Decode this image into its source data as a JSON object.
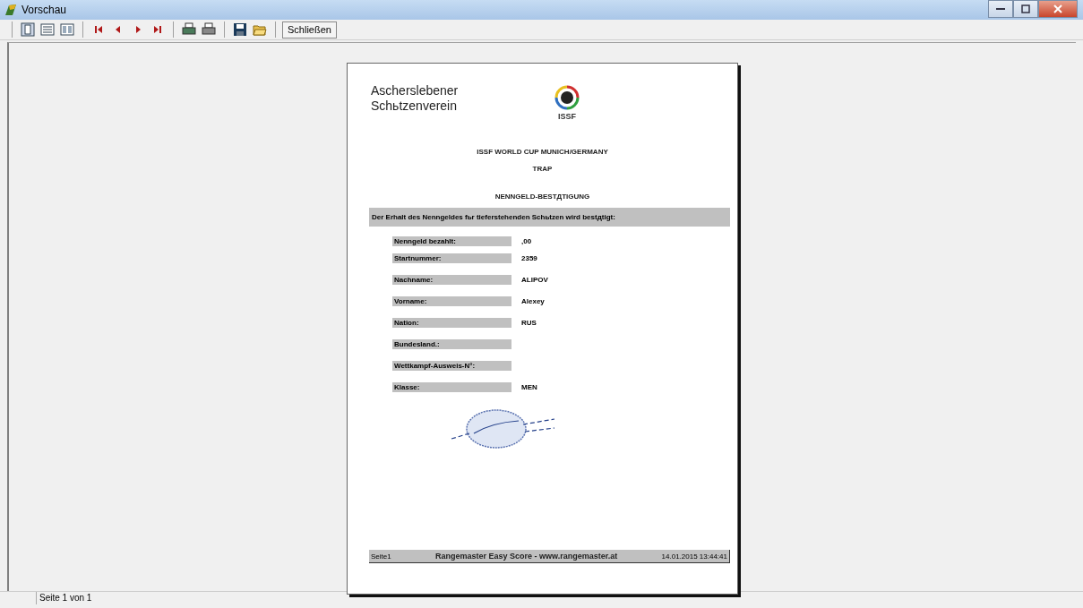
{
  "window": {
    "title": "Vorschau"
  },
  "toolbar": {
    "close_button": "Schließen"
  },
  "document": {
    "club": [
      "Ascherslebener",
      "Schьtzenverein"
    ],
    "logo_text": "ISSF",
    "event": "ISSF WORLD CUP MUNICH/GERMANY",
    "discipline": "TRAP",
    "heading": "NENNGELD-BESTДTIGUNG",
    "banner": "Der Erhalt des Nenngeldes fьr tieferstehenden Schьtzen wird bestдtigt:",
    "fields": [
      {
        "label": "Nenngeld bezahlt:",
        "value": ",00"
      },
      {
        "label": "Startnummer:",
        "value": "2359"
      },
      {
        "label": "Nachname:",
        "value": "ALIPOV"
      },
      {
        "label": "Vorname:",
        "value": "Alexey"
      },
      {
        "label": "Nation:",
        "value": "RUS"
      },
      {
        "label": "Bundesland.:"
      },
      {
        "label": "Wettkampf-Ausweis-N°:"
      },
      {
        "label": "Klasse:",
        "value": "MEN"
      }
    ],
    "footer": {
      "page": "Seite1",
      "center": "Rangemaster Easy Score - www.rangemaster.at",
      "timestamp": "14.01.2015 13:44:41"
    }
  },
  "status_bar": {
    "text": "Seite 1 von 1"
  }
}
